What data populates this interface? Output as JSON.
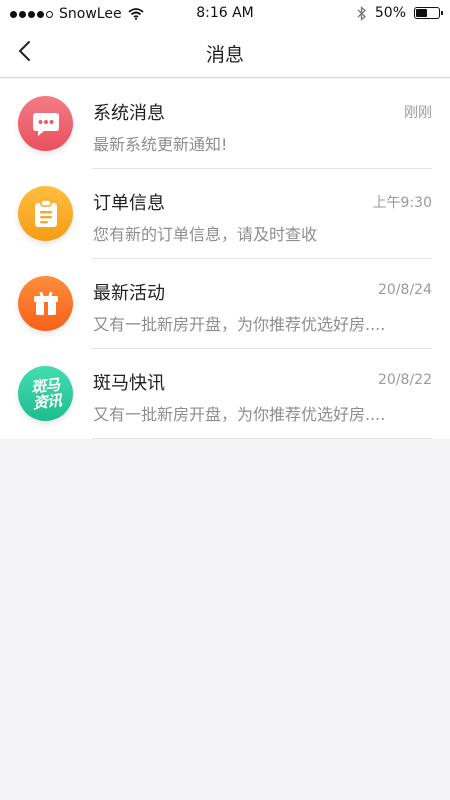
{
  "status_bar": {
    "carrier": "SnowLee",
    "time": "8:16 AM",
    "battery_percent": "50%",
    "battery_level": 0.5,
    "signal_bars": 4,
    "signal_total": 5
  },
  "nav": {
    "title": "消息"
  },
  "messages": [
    {
      "title": "系统消息",
      "time": "刚刚",
      "desc": "最新系统更新通知!",
      "icon": "chat-bubble-icon",
      "color": "#ec5c68"
    },
    {
      "title": "订单信息",
      "time": "上午9:30",
      "desc": "您有新的订单信息，请及时查收",
      "icon": "clipboard-icon",
      "color": "#f8a825"
    },
    {
      "title": "最新活动",
      "time": "20/8/24",
      "desc": "又有一批新房开盘，为你推荐优选好房....",
      "icon": "gift-box-icon",
      "color": "#f7722a"
    },
    {
      "title": "斑马快讯",
      "time": "20/8/22",
      "desc": "又有一批新房开盘，为你推荐优选好房....",
      "icon": "zebra-news-logo",
      "color": "#2bc99b",
      "logo_text": [
        "斑马",
        "资讯"
      ]
    }
  ]
}
